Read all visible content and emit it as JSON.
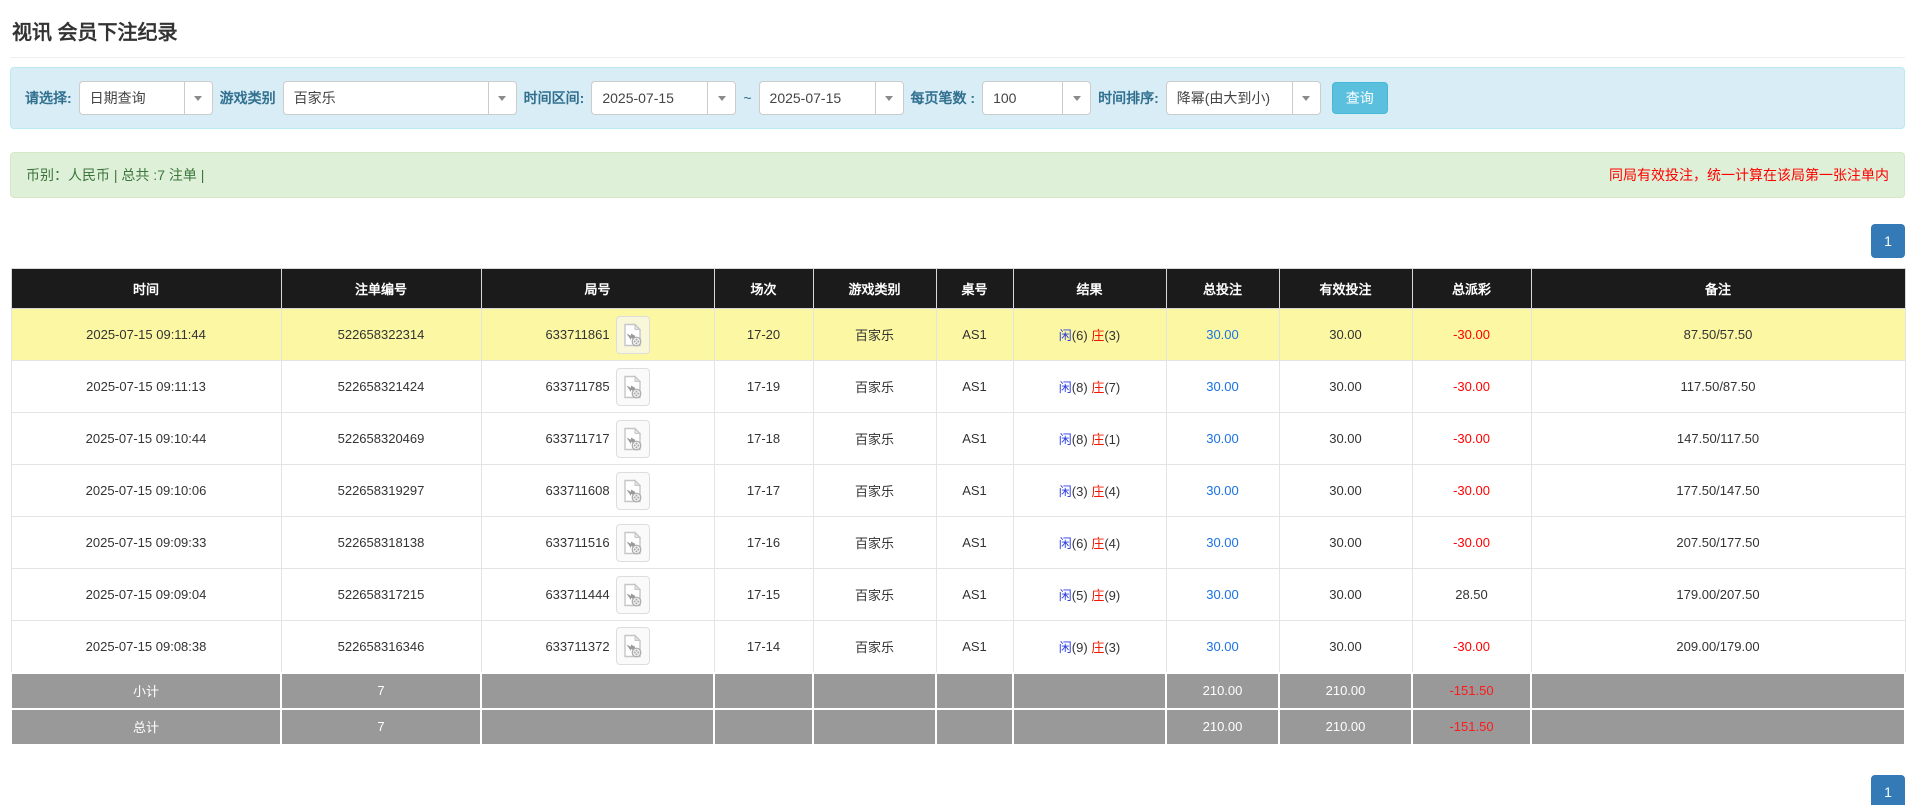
{
  "page": {
    "title": "视讯 会员下注纪录"
  },
  "filters": {
    "select_label": "请选择:",
    "select_value": "日期查询",
    "game_type_label": "游戏类别",
    "game_type_value": "百家乐",
    "time_range_label": "时间区间:",
    "time_from": "2025-07-15",
    "tilde": "~",
    "time_to": "2025-07-15",
    "page_size_label": "每页笔数 :",
    "page_size_value": "100",
    "sort_label": "时间排序:",
    "sort_value": "降幂(由大到小)",
    "search_button": "查询"
  },
  "summary": {
    "left_text": "币别：人民币 | 总共 :7 注单 |",
    "right_notice": "同局有效投注，统一计算在该局第一张注单内"
  },
  "pagination": {
    "page": "1"
  },
  "colors": {
    "accent_blue": "#337ab7",
    "search_button": "#5bc0de",
    "panel_blue": "#d9edf7",
    "summary_green": "#dff0d8",
    "header_black": "#1b1b1b",
    "highlight_yellow": "#fbf7a3",
    "totals_gray": "#999999",
    "player_blue": "#2c3ee0",
    "banker_red": "#f01800",
    "negative_red": "#ff0000",
    "bet_link_blue": "#1a73e8"
  },
  "icons": {
    "caret": "chevron-down-icon",
    "video": "video-file-icon"
  },
  "table": {
    "headers": [
      "时间",
      "注单编号",
      "局号",
      "场次",
      "游戏类别",
      "桌号",
      "结果",
      "总投注",
      "有效投注",
      "总派彩",
      "备注"
    ],
    "rows": [
      {
        "time": "2025-07-15 09:11:44",
        "bet_id": "522658322314",
        "round_id": "633711861",
        "session": "17-20",
        "game": "百家乐",
        "table_id": "AS1",
        "player": "闲",
        "player_pts": "(6)",
        "banker": "庄",
        "banker_pts": "(3)",
        "total_bet": "30.00",
        "valid_bet": "30.00",
        "payout": "-30.00",
        "remark": "87.50/57.50",
        "highlight": true
      },
      {
        "time": "2025-07-15 09:11:13",
        "bet_id": "522658321424",
        "round_id": "633711785",
        "session": "17-19",
        "game": "百家乐",
        "table_id": "AS1",
        "player": "闲",
        "player_pts": "(8)",
        "banker": "庄",
        "banker_pts": "(7)",
        "total_bet": "30.00",
        "valid_bet": "30.00",
        "payout": "-30.00",
        "remark": "117.50/87.50",
        "highlight": false
      },
      {
        "time": "2025-07-15 09:10:44",
        "bet_id": "522658320469",
        "round_id": "633711717",
        "session": "17-18",
        "game": "百家乐",
        "table_id": "AS1",
        "player": "闲",
        "player_pts": "(8)",
        "banker": "庄",
        "banker_pts": "(1)",
        "total_bet": "30.00",
        "valid_bet": "30.00",
        "payout": "-30.00",
        "remark": "147.50/117.50",
        "highlight": false
      },
      {
        "time": "2025-07-15 09:10:06",
        "bet_id": "522658319297",
        "round_id": "633711608",
        "session": "17-17",
        "game": "百家乐",
        "table_id": "AS1",
        "player": "闲",
        "player_pts": "(3)",
        "banker": "庄",
        "banker_pts": "(4)",
        "total_bet": "30.00",
        "valid_bet": "30.00",
        "payout": "-30.00",
        "remark": "177.50/147.50",
        "highlight": false
      },
      {
        "time": "2025-07-15 09:09:33",
        "bet_id": "522658318138",
        "round_id": "633711516",
        "session": "17-16",
        "game": "百家乐",
        "table_id": "AS1",
        "player": "闲",
        "player_pts": "(6)",
        "banker": "庄",
        "banker_pts": "(4)",
        "total_bet": "30.00",
        "valid_bet": "30.00",
        "payout": "-30.00",
        "remark": "207.50/177.50",
        "highlight": false
      },
      {
        "time": "2025-07-15 09:09:04",
        "bet_id": "522658317215",
        "round_id": "633711444",
        "session": "17-15",
        "game": "百家乐",
        "table_id": "AS1",
        "player": "闲",
        "player_pts": "(5)",
        "banker": "庄",
        "banker_pts": "(9)",
        "total_bet": "30.00",
        "valid_bet": "30.00",
        "payout": "28.50",
        "remark": "179.00/207.50",
        "highlight": false
      },
      {
        "time": "2025-07-15 09:08:38",
        "bet_id": "522658316346",
        "round_id": "633711372",
        "session": "17-14",
        "game": "百家乐",
        "table_id": "AS1",
        "player": "闲",
        "player_pts": "(9)",
        "banker": "庄",
        "banker_pts": "(3)",
        "total_bet": "30.00",
        "valid_bet": "30.00",
        "payout": "-30.00",
        "remark": "209.00/179.00",
        "highlight": false
      }
    ],
    "subtotal": {
      "label": "小计",
      "count": "7",
      "total_bet": "210.00",
      "valid_bet": "210.00",
      "payout": "-151.50"
    },
    "total": {
      "label": "总计",
      "count": "7",
      "total_bet": "210.00",
      "valid_bet": "210.00",
      "payout": "-151.50"
    }
  }
}
